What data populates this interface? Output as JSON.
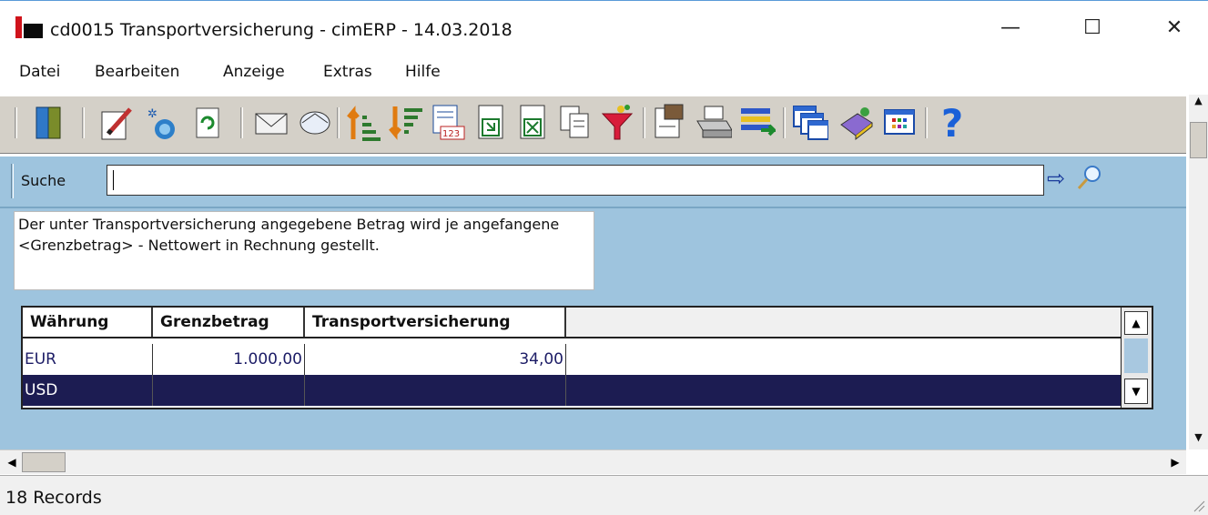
{
  "window": {
    "title": "cd0015 Transportversicherung - cimERP - 14.03.2018",
    "minimize_glyph": "—",
    "maximize_glyph": "☐",
    "close_glyph": "✕"
  },
  "menu": [
    "Datei",
    "Bearbeiten",
    "Anzeige",
    "Extras",
    "Hilfe"
  ],
  "toolbar": {
    "icons": [
      "exit-door-icon",
      "edit-pencil-icon",
      "new-record-icon",
      "refresh-icon",
      "mail-icon",
      "sort-ascending-icon",
      "sort-descending-icon",
      "calendar-123-icon",
      "export-icon",
      "excel-export-icon",
      "copy-icon",
      "filter-icon",
      "properties-icon",
      "print-icon",
      "list-transfer-icon",
      "windows-icon",
      "book-icon",
      "grid-view-icon",
      "help-icon"
    ],
    "help_glyph": "?"
  },
  "search": {
    "label": "Suche",
    "value": "",
    "go_glyph": "⇨",
    "magnifier_glyph": "⌕"
  },
  "note": "Der unter Transportversicherung angegebene Betrag wird je angefangene <Grenzbetrag> - Nettowert in Rechnung gestellt.",
  "grid": {
    "columns": [
      "Währung",
      "Grenzbetrag",
      "Transportversicherung"
    ],
    "rows": [
      {
        "waehrung": "EUR",
        "grenzbetrag": "1.000,00",
        "transport": "34,00",
        "selected": false
      },
      {
        "waehrung": "USD",
        "grenzbetrag": "",
        "transport": "",
        "selected": true
      }
    ]
  },
  "status": {
    "records": "18 Records"
  },
  "colors": {
    "panel": "#9ec4de",
    "selected_row": "#1c1c52",
    "text_blue": "#1c1c66",
    "logo_red": "#d0131b"
  }
}
